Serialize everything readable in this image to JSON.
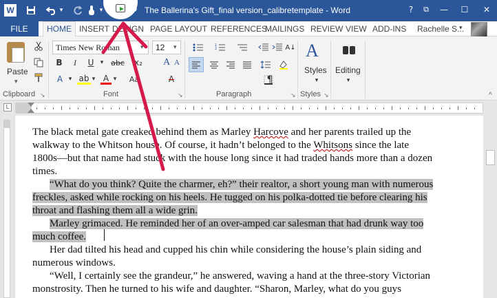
{
  "titlebar": {
    "app_letter": "W",
    "title": "The Ballerina's Gift_final version_calibretemplate - Word",
    "help": "?",
    "restore": "⧉",
    "minimize": "—",
    "maximize": "☐",
    "close": "✕",
    "qat_undo_caret": "▾",
    "qat_customize": "▾"
  },
  "tabs": {
    "file": "FILE",
    "items": [
      "HOME",
      "INSERT",
      "DESIGN",
      "PAGE LAYOUT",
      "REFERENCES",
      "MAILINGS",
      "REVIEW",
      "VIEW",
      "ADD-INS"
    ],
    "user": "Rachelle S...",
    "user_caret": "▾"
  },
  "ribbon": {
    "clipboard": {
      "paste": "Paste",
      "paste_caret": "▾",
      "label": "Clipboard"
    },
    "font": {
      "name": "Times New Roman",
      "size": "12",
      "caret": "▾",
      "bold": "B",
      "italic": "I",
      "underline": "U",
      "strikethrough": "abc",
      "subscript": "x₂",
      "font_color": "A",
      "highlight": "ab",
      "grow": "A",
      "shrink": "A",
      "change_case": "Aa",
      "clear_format": "A",
      "label": "Font"
    },
    "paragraph": {
      "label": "Paragraph",
      "pilcrow": "¶",
      "sort": "A↓"
    },
    "styles": {
      "label": "Styles",
      "button": "Styles",
      "caret": "▾",
      "icon_letter": "A"
    },
    "editing": {
      "button": "Editing",
      "caret": "▾"
    },
    "collapse": "^"
  },
  "ruler": {
    "tab_selector": "L"
  },
  "document": {
    "lines": [
      {
        "segments": [
          {
            "t": "The black metal gate creaked behind them as Marley "
          },
          {
            "t": "Harcove",
            "sq": true
          },
          {
            "t": " and her parents trailed up the"
          }
        ]
      },
      {
        "segments": [
          {
            "t": "walkway to the Whitson house. Of course, it hadn’t belonged to the "
          },
          {
            "t": "Whitsons",
            "sq": true
          },
          {
            "t": " since the late"
          }
        ]
      },
      {
        "segments": [
          {
            "t": "1800s—but that name had stuck with the house long since it had traded hands more than a dozen"
          }
        ]
      },
      {
        "segments": [
          {
            "t": "times."
          }
        ]
      },
      {
        "indent": true,
        "sel": true,
        "segments": [
          {
            "t": "“What do you think? Quite the charmer, eh?” their realtor, a short young man with numerous"
          }
        ]
      },
      {
        "sel": true,
        "segments": [
          {
            "t": "freckles, asked while rocking on his heels. He tugged on his polka-dotted tie before clearing his"
          }
        ]
      },
      {
        "sel": true,
        "segments": [
          {
            "t": "throat and flashing them all a wide grin."
          }
        ]
      },
      {
        "indent": true,
        "sel": true,
        "segments": [
          {
            "t": "Marley grimaced. He reminded her of an over-amped car salesman that had drunk way too"
          }
        ]
      },
      {
        "sel": true,
        "segments": [
          {
            "t": "much coffee."
          }
        ]
      },
      {
        "indent": true,
        "segments": [
          {
            "t": "Her dad tilted his head and cupped his chin while considering the house’s plain siding and"
          }
        ]
      },
      {
        "segments": [
          {
            "t": "numerous windows."
          }
        ]
      },
      {
        "indent": true,
        "segments": [
          {
            "t": "“Well, I certainly see the grandeur,” he answered, waving a hand at the three-story Victorian"
          }
        ]
      },
      {
        "segments": [
          {
            "t": "monstrosity. Then he turned to his wife and daughter. “Sharon, Marley, what do you guys"
          }
        ]
      },
      {
        "segments": [
          {
            "t": "think?”"
          }
        ]
      }
    ]
  },
  "colors": {
    "word_blue": "#2b579a",
    "annotation_arrow": "#d6194b",
    "selection": "#c0c0c0",
    "spell_squiggle": "#c00000"
  },
  "icons": [
    "word-logo-icon",
    "save-icon",
    "undo-icon",
    "redo-icon",
    "touch-mode-icon",
    "comment-icon",
    "help-icon",
    "restore-icon",
    "minimize-icon",
    "maximize-icon",
    "close-icon",
    "paste-icon",
    "cut-icon",
    "copy-icon",
    "format-painter-icon",
    "styles-icon",
    "binoculars-icon"
  ]
}
